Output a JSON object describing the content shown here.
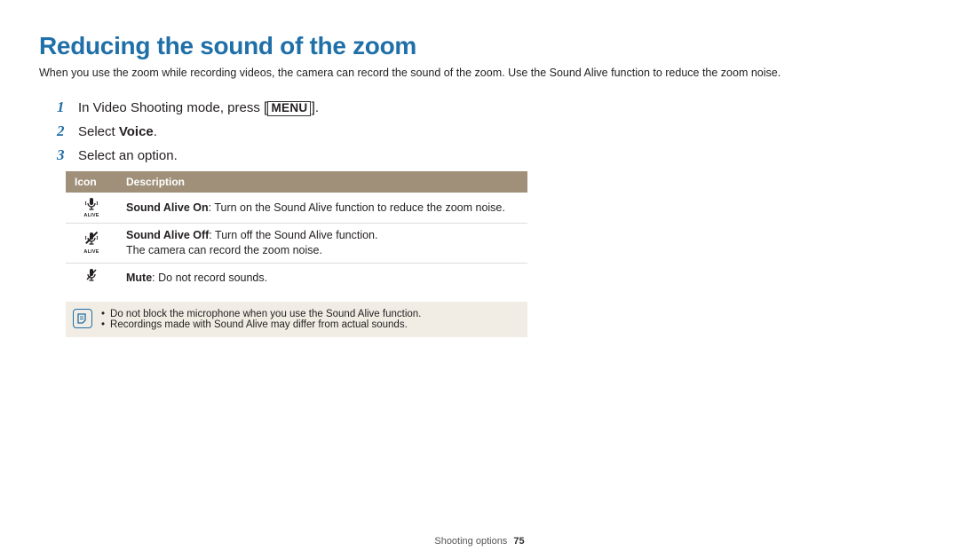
{
  "title": "Reducing the sound of the zoom",
  "intro": "When you use the zoom while recording videos, the camera can record the sound of the zoom. Use the Sound Alive function to reduce the zoom noise.",
  "steps": {
    "s1_pre": "In Video Shooting mode, press ",
    "s1_btn": "MENU",
    "s1_post": ".",
    "s2_pre": "Select ",
    "s2_bold": "Voice",
    "s2_post": ".",
    "s3": "Select an option."
  },
  "table": {
    "head_icon": "Icon",
    "head_desc": "Description",
    "rows": [
      {
        "icon_label": "ALIVE",
        "bold": "Sound Alive On",
        "rest": ": Turn on the Sound Alive function to reduce the zoom noise."
      },
      {
        "icon_label": "ALIVE",
        "bold": "Sound Alive Off",
        "rest": ": Turn off the Sound Alive function.",
        "line2": "The camera can record the zoom noise."
      },
      {
        "icon_label": "",
        "bold": "Mute",
        "rest": ": Do not record sounds."
      }
    ]
  },
  "note": {
    "items": [
      "Do not block the microphone when you use the Sound Alive function.",
      "Recordings made with Sound Alive may differ from actual sounds."
    ]
  },
  "footer": {
    "section": "Shooting options",
    "page": "75"
  }
}
